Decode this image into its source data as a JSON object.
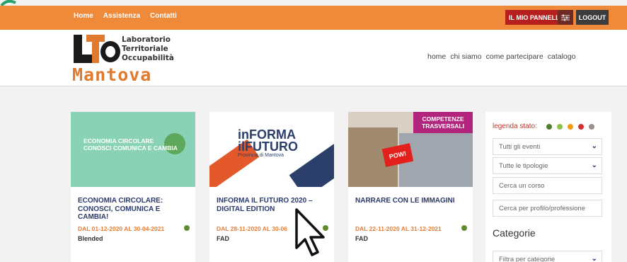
{
  "topbar": {
    "nav": [
      "Home",
      "Assistenza",
      "Contatti"
    ],
    "panel_label": "IL MIO PANNELLO",
    "logout_label": "LOGOUT"
  },
  "logo": {
    "line1": "Laboratorio",
    "line2": "Territoriale",
    "line3": "Occupabilità",
    "city": "Mantova"
  },
  "mainnav": [
    "home",
    "chi siamo",
    "come partecipare",
    "catalogo"
  ],
  "cards": [
    {
      "thumb_text": [
        "ECONOMIA CIRCOLARE",
        "CONOSCI COMUNICA E CAMBIA"
      ],
      "title": "ECONOMIA CIRCOLARE: CONOSCI, COMUNICA E CAMBIA!",
      "dates": "DAL 01-12-2020 AL 30-04-2021",
      "mode": "Blended"
    },
    {
      "thumb_text": [
        "inFORMA",
        "ilFUTURO",
        "Provincia di Mantova"
      ],
      "title": "INFORMA IL FUTURO 2020 – DIGITAL EDITION",
      "dates": "DAL 28-11-2020 AL 30-06",
      "mode": "FAD"
    },
    {
      "thumb_text": [
        "COMPETENZE",
        "TRASVERSALI",
        "POW!"
      ],
      "title": "NARRARE CON LE IMMAGINI",
      "dates": "DAL 22-11-2020 AL 31-12-2021",
      "mode": "FAD"
    }
  ],
  "sidebar": {
    "legend_label": "legenda stato:",
    "legend_colors": [
      "#4e7f2a",
      "#8bc34a",
      "#f39c12",
      "#d32f2f",
      "#9e8e8e"
    ],
    "filter_events": "Tutti gli eventi",
    "filter_types": "Tutte le tipologie",
    "search_course_placeholder": "Cerca un corso",
    "search_profile_placeholder": "Cerca per profilo/professione",
    "categories_title": "Categorie",
    "filter_category": "Filtra per categorie"
  },
  "colors": {
    "accent_orange": "#ee8a3a",
    "title_navy": "#2b3a6b",
    "date_orange": "#e57e34",
    "status_green": "#5e8c2e"
  }
}
